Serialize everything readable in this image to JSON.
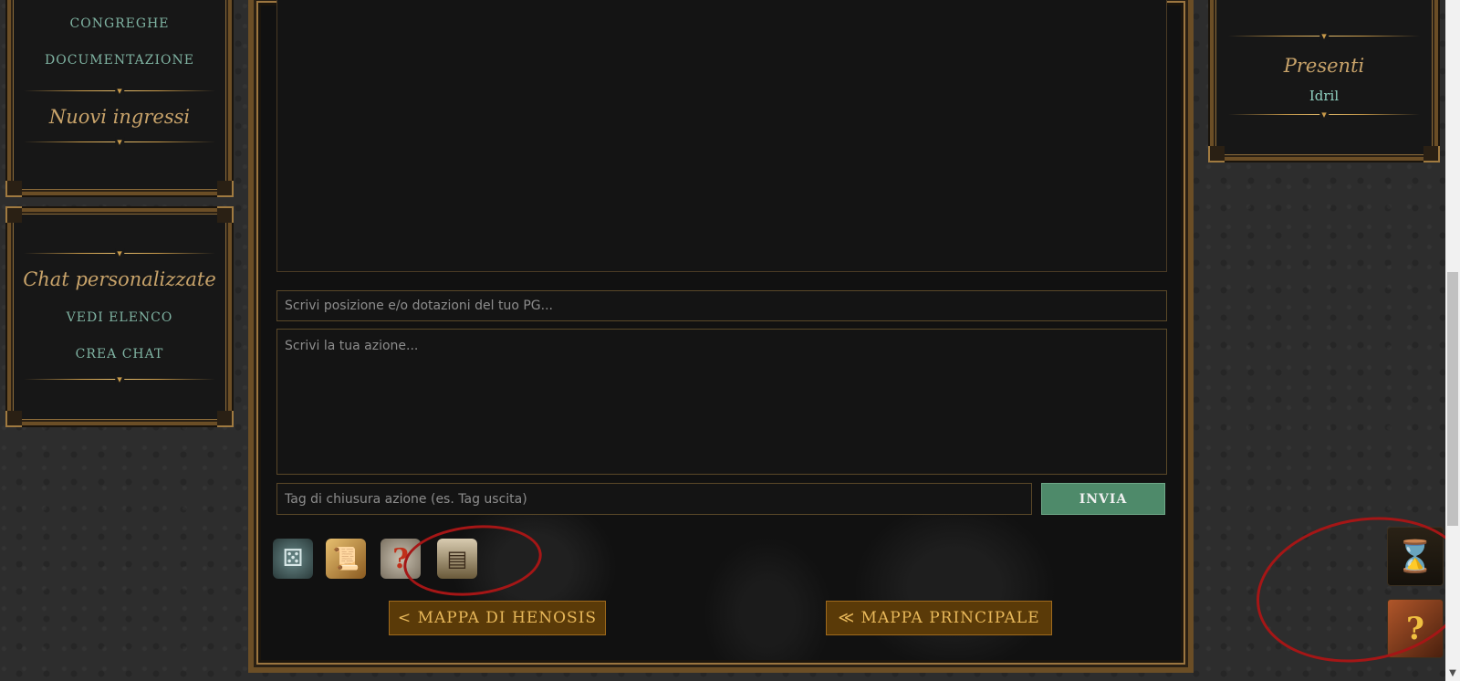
{
  "left_nav": {
    "links": [
      "CONGREGHE",
      "DOCUMENTAZIONE"
    ],
    "heading": "Nuovi ingressi"
  },
  "custom_chat": {
    "heading": "Chat personalizzate",
    "links": [
      "VEDI ELENCO",
      "CREA CHAT"
    ]
  },
  "present_panel": {
    "heading": "Presenti",
    "users": [
      "Idril"
    ]
  },
  "chat": {
    "position_placeholder": "Scrivi posizione e/o dotazioni del tuo PG...",
    "action_placeholder": "Scrivi la tua azione...",
    "tag_placeholder": "Tag di chiusura azione (es. Tag uscita)",
    "send_label": "INVIA"
  },
  "tools": {
    "icons": [
      "dice-icon",
      "scroll-icon",
      "help-icon",
      "chest-icon"
    ]
  },
  "maps": {
    "henosis_label": "< MAPPA DI HENOSIS",
    "main_label": "≪ MAPPA PRINCIPALE"
  },
  "side_buttons": {
    "icons": [
      "hourglass-scroll-icon",
      "help-book-icon"
    ]
  },
  "colors": {
    "link": "#7fb3a2",
    "heading_gold": "#c8a36a",
    "send_button": "#4e8a6a",
    "map_button": "#5a3a08",
    "annotation_red": "#a51616"
  }
}
